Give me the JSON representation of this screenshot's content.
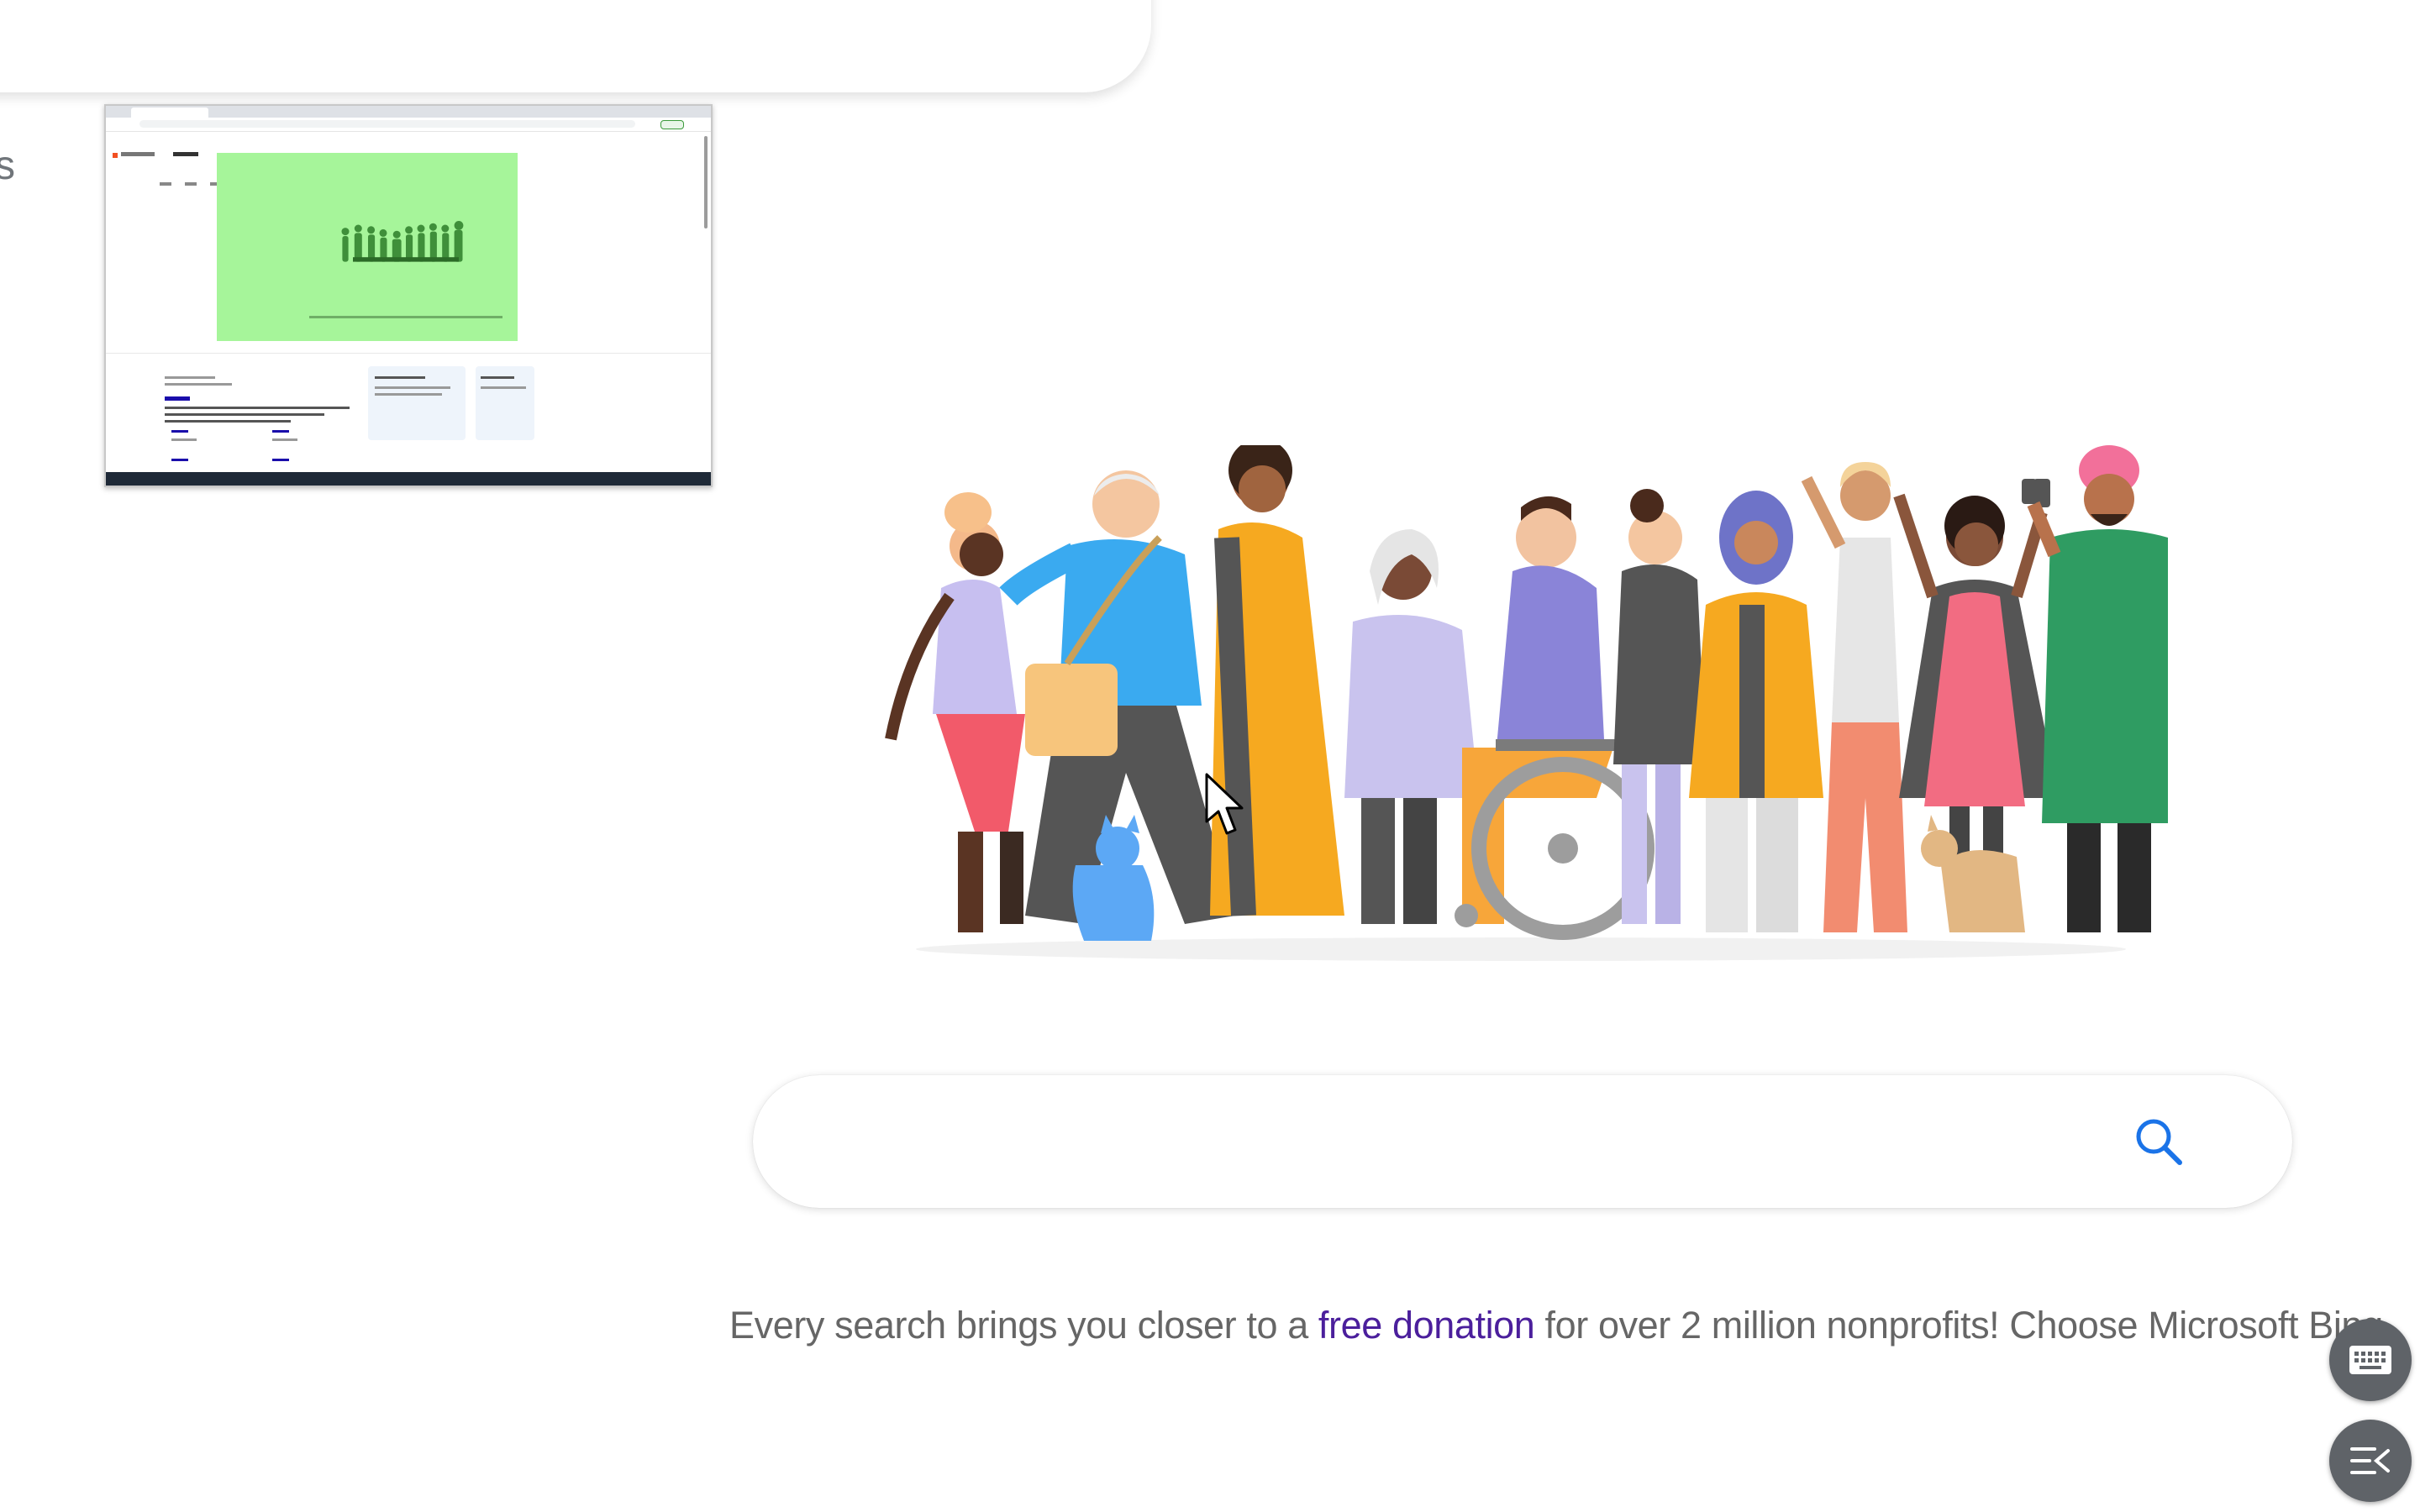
{
  "top_bar": {
    "keyboard_icon": "keyboard-icon",
    "mic_icon": "microphone-icon",
    "partial_text": "s"
  },
  "thumbnail": {
    "description_icon": "browser-screenshot-preview"
  },
  "search": {
    "value": "",
    "placeholder": "",
    "button_icon": "search-icon"
  },
  "tagline": {
    "before": "Every search brings you closer to a ",
    "link": "free donation",
    "after": " for over 2 million nonprofits! Choose Microsoft Bing."
  },
  "floating": {
    "keyboard_icon": "keyboard-icon",
    "menu_icon": "collapse-menu-icon"
  },
  "colors": {
    "accent_blue": "#1a73e8",
    "link_purple": "#4b1f9c",
    "fab_gray": "#5f6368",
    "thumbnail_green": "#a6f59a"
  }
}
